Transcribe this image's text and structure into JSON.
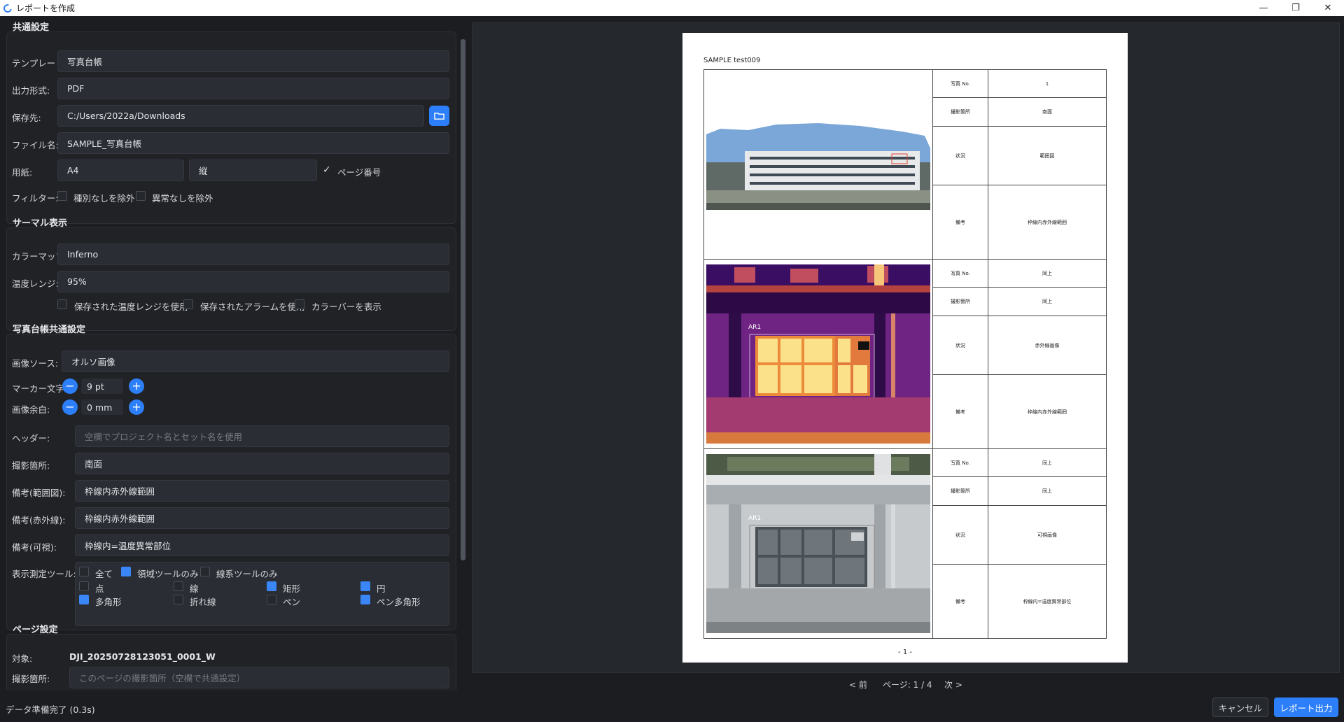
{
  "window": {
    "title": "レポートを作成",
    "minimize": "—",
    "maximize": "❐",
    "close": "✕"
  },
  "common": {
    "title": "共通設定",
    "template_label": "テンプレート:",
    "template_value": "写真台帳",
    "format_label": "出力形式:",
    "format_value": "PDF",
    "save_label": "保存先:",
    "save_value": "C:/Users/2022a/Downloads",
    "filename_label": "ファイル名:",
    "filename_value": "SAMPLE_写真台帳",
    "paper_label": "用紙:",
    "paper_size": "A4",
    "paper_orientation": "縦",
    "page_number_check": "✓",
    "page_number_label": "ページ番号",
    "filter_label": "フィルター:",
    "filter_no_type": "種別なしを除外",
    "filter_no_anomaly": "異常なしを除外"
  },
  "thermal": {
    "title": "サーマル表示",
    "colormap_label": "カラーマップ:",
    "colormap_value": "Inferno",
    "range_label": "温度レンジ:",
    "range_value": "95%",
    "use_saved_range": "保存された温度レンジを使用",
    "use_saved_alarm": "保存されたアラームを使用",
    "show_colorbar": "カラーバーを表示"
  },
  "ledger": {
    "title": "写真台帳共通設定",
    "source_label": "画像ソース:",
    "source_value": "オルソ画像",
    "marker_label": "マーカー文字:",
    "marker_value": "9 pt",
    "margin_label": "画像余白:",
    "margin_value": "0 mm",
    "minus": "−",
    "plus": "+",
    "header_label": "ヘッダー:",
    "header_placeholder": "空欄でプロジェクト名とセット名を使用",
    "location_label": "撮影箇所:",
    "location_value": "南面",
    "note_range_label": "備考(範囲図):",
    "note_range_value": "枠線内赤外線範囲",
    "note_ir_label": "備考(赤外線):",
    "note_ir_value": "枠線内赤外線範囲",
    "note_visible_label": "備考(可視):",
    "note_visible_value": "枠線内=温度異常部位",
    "tools_label": "表示測定ツール:",
    "tools": {
      "all": "全て",
      "area_only": "領域ツールのみ",
      "line_only": "線系ツールのみ",
      "point": "点",
      "line": "線",
      "rect": "矩形",
      "circle": "円",
      "polygon": "多角形",
      "polyline": "折れ線",
      "pen": "ペン",
      "pen_polygon": "ペン多角形"
    }
  },
  "page_settings": {
    "title": "ページ設定",
    "target_label": "対象:",
    "target_value": "DJI_20250728123051_0001_W",
    "location_label": "撮影箇所:",
    "location_placeholder": "このページの撮影箇所（空欄で共通設定）"
  },
  "preview": {
    "header": "SAMPLE test009",
    "page_number": "- 1 -",
    "rows": [
      {
        "photo_no_label": "写真 No.",
        "photo_no": "1",
        "loc_label": "撮影箇所",
        "loc": "南面",
        "status_label": "状況",
        "status": "範囲図",
        "note_label": "備考",
        "note": "枠線内赤外線範囲",
        "marker": ""
      },
      {
        "photo_no_label": "写真 No.",
        "photo_no": "同上",
        "loc_label": "撮影箇所",
        "loc": "同上",
        "status_label": "状況",
        "status": "赤外線画像",
        "note_label": "備考",
        "note": "枠線内赤外線範囲",
        "marker": "AR1"
      },
      {
        "photo_no_label": "写真 No.",
        "photo_no": "同上",
        "loc_label": "撮影箇所",
        "loc": "同上",
        "status_label": "状況",
        "status": "可視画像",
        "note_label": "備考",
        "note": "枠線内=温度異常部位",
        "marker": "AR1"
      }
    ]
  },
  "pager": {
    "prev": "< 前",
    "page_info": "ページ: 1 / 4",
    "next": "次 >"
  },
  "status": {
    "message": "データ準備完了 (0.3s)"
  },
  "actions": {
    "cancel": "キャンセル",
    "export": "レポート出力"
  },
  "colors": {
    "accent": "#2d7ff9",
    "background": "#1b1d21",
    "panel": "#202226"
  }
}
